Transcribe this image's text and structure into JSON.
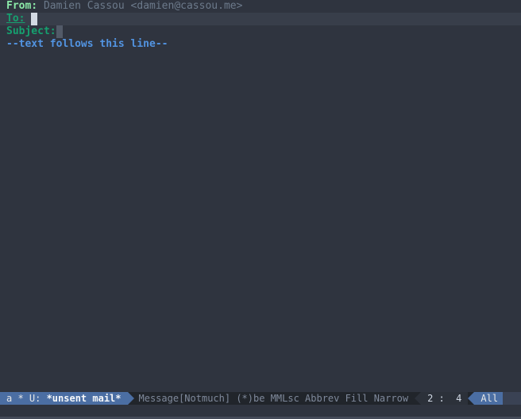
{
  "headers": {
    "from_key": "From:",
    "from_val": "Damien Cassou <damien@cassou.me>",
    "to_key": "To:",
    "to_val": "",
    "subject_key": "Subject:",
    "subject_val": ""
  },
  "separator": "--text follows this line--",
  "modeline": {
    "left_prefix": "a * U: ",
    "buffer_name": "*unsent mail*",
    "modes": "Message[Notmuch] (*)be MMLsc Abbrev Fill Narrow",
    "position": "2 :  4",
    "percent": "All"
  }
}
